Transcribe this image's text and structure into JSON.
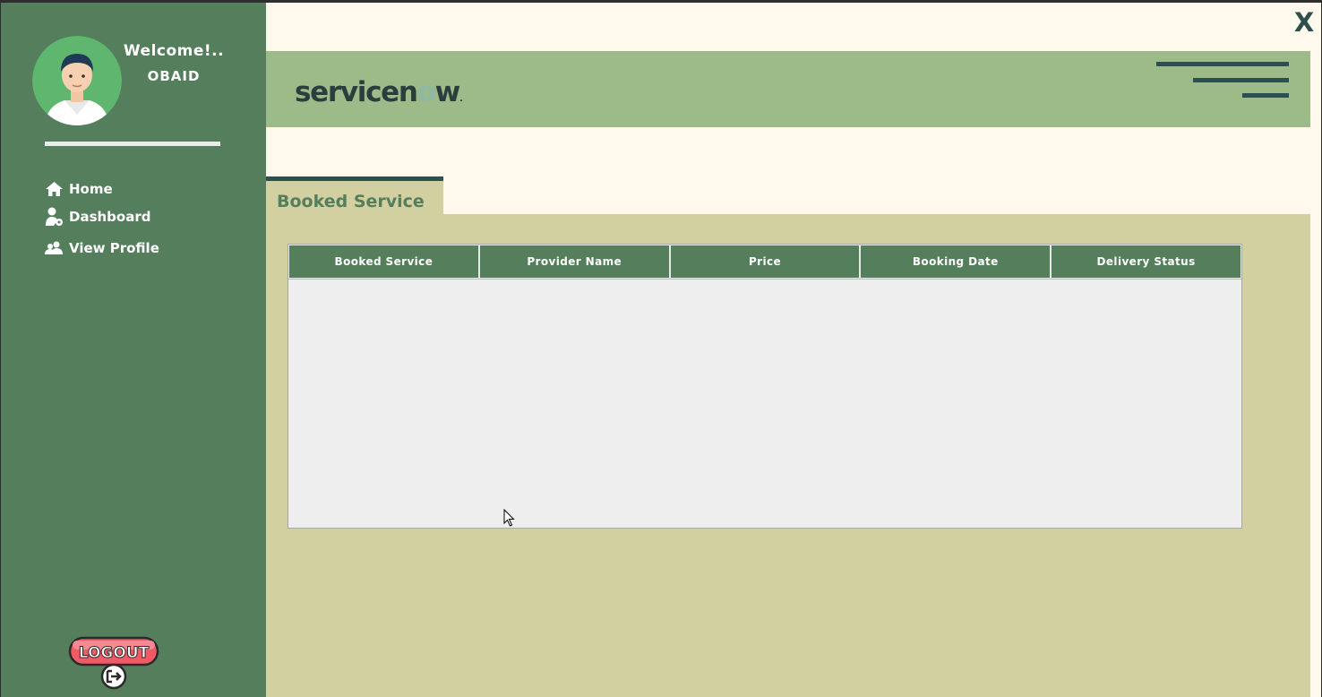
{
  "window": {
    "close_label": "X"
  },
  "sidebar": {
    "welcome": "Welcome!..",
    "username": "OBAID",
    "nav": [
      {
        "label": "Home",
        "icon": "home-icon"
      },
      {
        "label": "Dashboard",
        "icon": "user-settings-icon"
      },
      {
        "label": "View Profile",
        "icon": "users-icon"
      }
    ],
    "logout_label": "LOGOUT"
  },
  "header": {
    "logo_text_1": "servicen",
    "logo_text_2": "o",
    "logo_text_3": "w",
    "logo_mark": "."
  },
  "tab": {
    "label": "Booked Service"
  },
  "table": {
    "columns": [
      "Booked Service",
      "Provider Name",
      "Price",
      "Booking Date",
      "Delivery Status"
    ],
    "rows": []
  },
  "colors": {
    "sidebar": "#547e5c",
    "header": "#9dbb89",
    "content": "#d2cfa0",
    "background": "#fef9ec",
    "accent_dark": "#2e4f4f",
    "logout_red": "#f05a64"
  }
}
